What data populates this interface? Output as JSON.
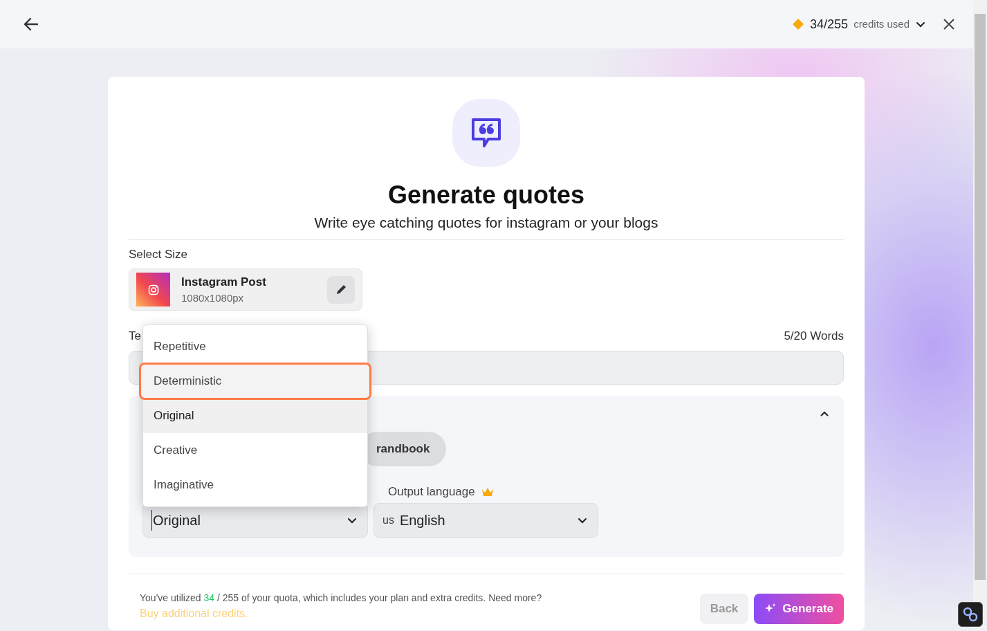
{
  "header": {
    "credits_used": "34/255",
    "credits_label": "credits used"
  },
  "tool": {
    "title": "Generate quotes",
    "subtitle": "Write eye catching quotes for instagram or your blogs"
  },
  "size": {
    "label": "Select Size",
    "name": "Instagram Post",
    "dimensions": "1080x1080px"
  },
  "text_input": {
    "label": "Te",
    "word_count": "5/20 Words"
  },
  "advanced": {
    "expanded": true,
    "pill": "randbook",
    "language_label": "Output language",
    "creativity_value": "Original",
    "language_flag": "us",
    "language_value": "English"
  },
  "dropdown": {
    "options": [
      {
        "label": "Repetitive",
        "selected": false,
        "focused": false
      },
      {
        "label": "Deterministic",
        "selected": false,
        "focused": true
      },
      {
        "label": "Original",
        "selected": true,
        "focused": false
      },
      {
        "label": "Creative",
        "selected": false,
        "focused": false
      },
      {
        "label": "Imaginative",
        "selected": false,
        "focused": false
      }
    ]
  },
  "footer": {
    "quota_prefix": "You've utilized",
    "quota_used": "34",
    "quota_rest": "/ 255 of your quota, which includes your plan and extra credits. Need more?",
    "buy_link": "Buy additional credits.",
    "back_button": {
      "label": "Back",
      "disabled": true
    },
    "generate_button": "Generate"
  }
}
